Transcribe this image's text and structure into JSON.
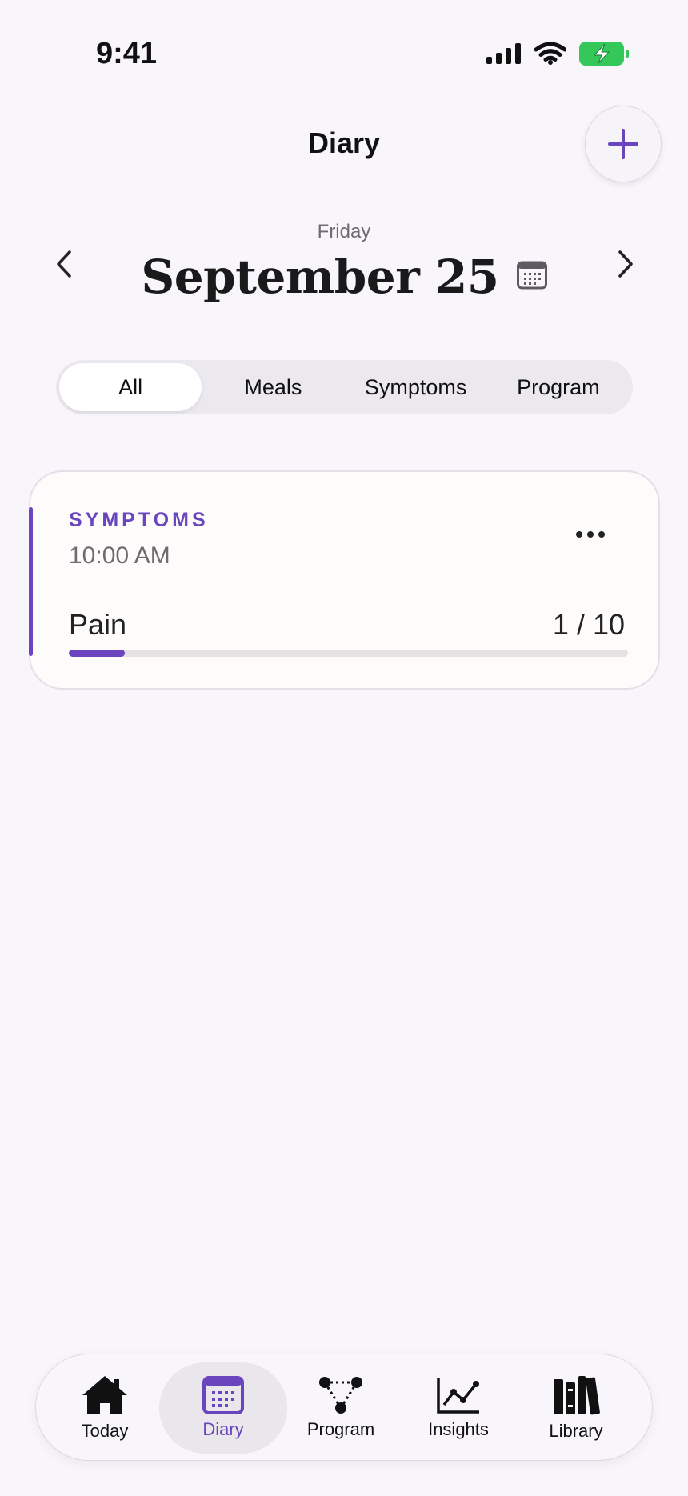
{
  "status": {
    "time": "9:41"
  },
  "header": {
    "title": "Diary"
  },
  "date": {
    "weekday": "Friday",
    "date": "September 25"
  },
  "filters": {
    "items": [
      {
        "label": "All",
        "active": true
      },
      {
        "label": "Meals",
        "active": false
      },
      {
        "label": "Symptoms",
        "active": false
      },
      {
        "label": "Program",
        "active": false
      }
    ]
  },
  "entry": {
    "category": "SYMPTOMS",
    "time": "10:00 AM",
    "metric": "Pain",
    "value_text": "1 / 10",
    "value": 1,
    "max": 10
  },
  "tabs": [
    {
      "label": "Today",
      "icon": "house-icon",
      "active": false
    },
    {
      "label": "Diary",
      "icon": "calendar-icon",
      "active": true
    },
    {
      "label": "Program",
      "icon": "program-icon",
      "active": false
    },
    {
      "label": "Insights",
      "icon": "chart-icon",
      "active": false
    },
    {
      "label": "Library",
      "icon": "books-icon",
      "active": false
    }
  ],
  "colors": {
    "accent": "#6a45bd",
    "battery": "#34c759",
    "background": "#f8f6fb"
  }
}
